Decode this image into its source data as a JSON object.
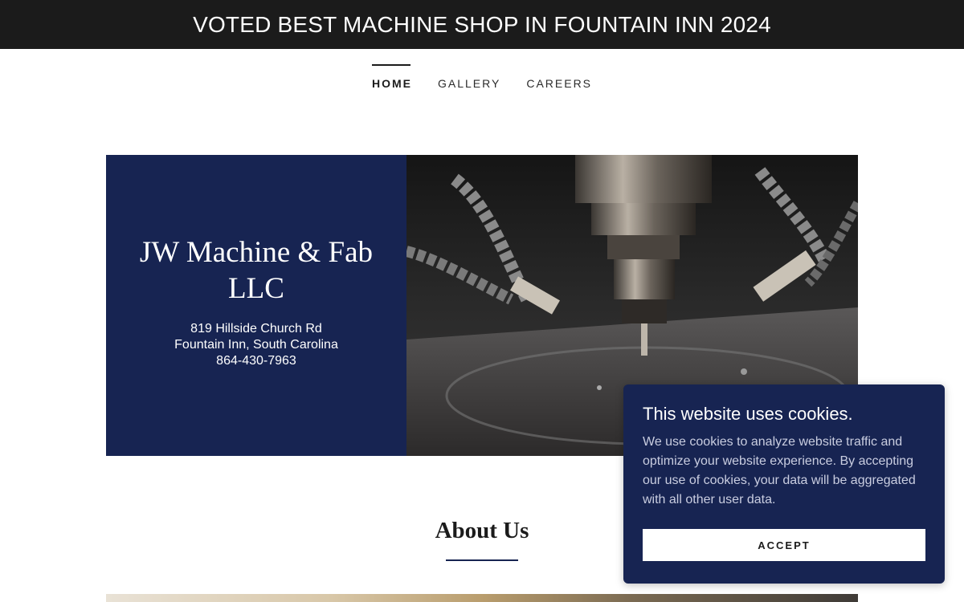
{
  "announcement": {
    "text": "VOTED BEST MACHINE SHOP IN FOUNTAIN INN 2024"
  },
  "nav": {
    "items": [
      {
        "label": "HOME",
        "active": true
      },
      {
        "label": "GALLERY",
        "active": false
      },
      {
        "label": "CAREERS",
        "active": false
      }
    ]
  },
  "hero": {
    "title": "JW Machine & Fab LLC",
    "address_line1": "819 Hillside Church Rd",
    "address_line2": "Fountain Inn, South Carolina",
    "phone": "864-430-7963",
    "image_icon": "cnc-machine-photo"
  },
  "about": {
    "title": "About Us"
  },
  "cookie": {
    "title": "This website uses cookies.",
    "text": "We use cookies to analyze website traffic and optimize your website experience. By accepting our use of cookies, your data will be aggregated with all other user data.",
    "accept_label": "ACCEPT"
  },
  "colors": {
    "navy": "#172452",
    "announcement_bg": "#1b1b1b"
  }
}
